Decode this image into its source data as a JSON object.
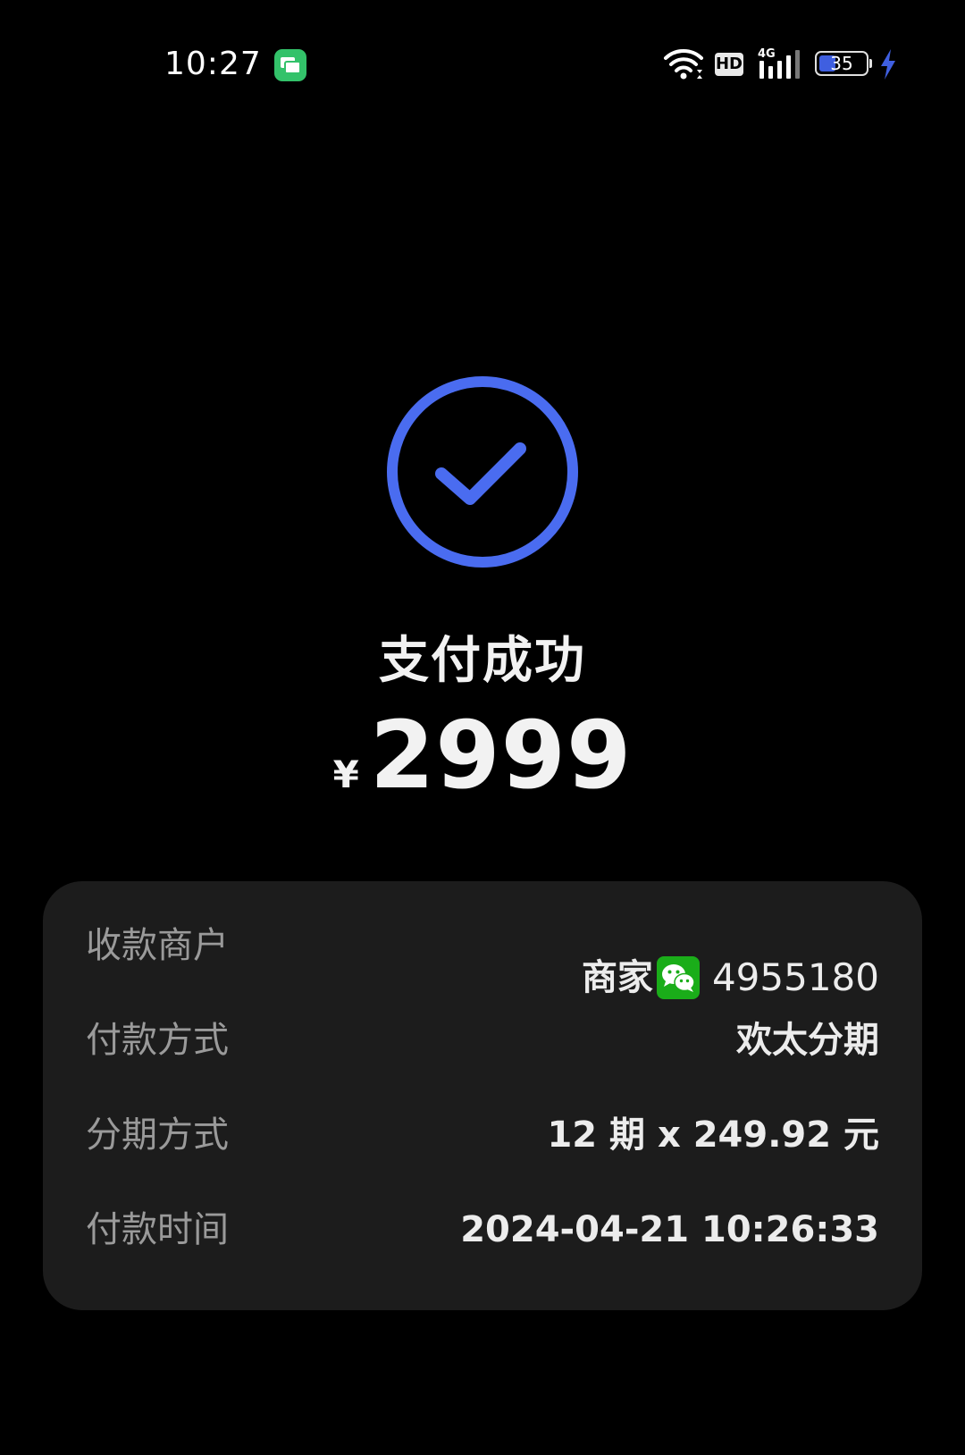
{
  "status_bar": {
    "time": "10:27",
    "notification_icon": "messages-app-icon",
    "hd_label": "HD",
    "network_label": "4G",
    "battery_level": "35",
    "battery_fraction": 0.35,
    "charging": true,
    "charging_color": "#3f5fe0"
  },
  "result": {
    "icon": "check-circle-icon",
    "icon_color": "#4a6cf0",
    "title": "支付成功",
    "currency_symbol": "¥",
    "amount": "2999"
  },
  "details": [
    {
      "label": "收款商户",
      "value_prefix": "商家",
      "value_icon": "wechat-icon",
      "value": "4955180"
    },
    {
      "label": "付款方式",
      "value": "欢太分期"
    },
    {
      "label": "分期方式",
      "value": "12 期 x 249.92 元"
    },
    {
      "label": "付款时间",
      "value": "2024-04-21 10:26:33"
    }
  ],
  "colors": {
    "background": "#000000",
    "card_background": "#1c1c1c",
    "label_color": "#9a9a9a",
    "value_color": "#ececec",
    "wechat_green": "#1aad19"
  }
}
